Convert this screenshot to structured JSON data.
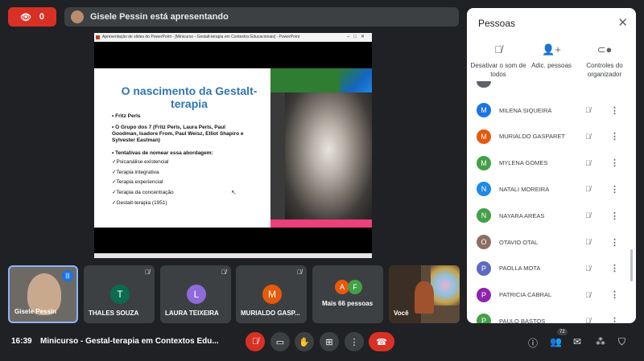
{
  "topbar": {
    "viewer_count": "0",
    "presenting_text": "Gisele Pessin está apresentando"
  },
  "slide": {
    "window_title": "Apresentação de slides do PowerPoint - [Minicurso - Gestalt-terapia em Contextos Educacionais] - PowerPoint",
    "title": "O nascimento da Gestalt-terapia",
    "bullets": [
      "Fritz Perls",
      "O Grupo dos 7 (Fritz Perls, Laura Perls, Paul Goodman, Isadore From, Paul Weisz, Elliot Shapiro e Sylvester Eastman)",
      "Tentativas de nomear essa abordagem:"
    ],
    "checks": [
      "Psicanálise existencial",
      "Terapia integrativa",
      "Terapia experiencial",
      "Terapia da concentração",
      "Gestalt-terapia (1951)"
    ]
  },
  "panel": {
    "title": "Pessoas",
    "actions": [
      "Desativar o som de todos",
      "Adic. pessoas",
      "Controles do organizador"
    ],
    "people": [
      {
        "initial": "M",
        "name": "MILENA SIQUEIRA",
        "color": "#1a73e8"
      },
      {
        "initial": "M",
        "name": "MURIALDO GASPARET",
        "color": "#e8590c"
      },
      {
        "initial": "M",
        "name": "MYLENA GOMES",
        "color": "#43a047"
      },
      {
        "initial": "N",
        "name": "NATALI MOREIRA",
        "color": "#1e88e5"
      },
      {
        "initial": "N",
        "name": "NAYARA AREAS",
        "color": "#43a047"
      },
      {
        "initial": "O",
        "name": "OTAVIO OTAL",
        "color": "#8d6e63"
      },
      {
        "initial": "P",
        "name": "PAOLLA MOTA",
        "color": "#5c6bc0"
      },
      {
        "initial": "P",
        "name": "PATRICIA CABRAL",
        "color": "#8e24aa"
      },
      {
        "initial": "P",
        "name": "PAULO BASTOS",
        "color": "#43a047"
      }
    ]
  },
  "tiles": [
    {
      "name": "Gisele Pessin"
    },
    {
      "name": "THALES SOUZA",
      "initial": "T",
      "color": "#0b6b4f"
    },
    {
      "name": "LAURA TEIXEIRA",
      "initial": "L",
      "color": "#8e6bd8"
    },
    {
      "name": "MURIALDO GASP...",
      "initial": "M",
      "color": "#e8590c"
    },
    {
      "name": "Mais 66 pessoas",
      "initials": [
        "A",
        "F"
      ]
    },
    {
      "name": "Você"
    }
  ],
  "bottombar": {
    "time": "16:39",
    "meeting_title": "Minicurso - Gestal-terapia em Contextos Edu...",
    "people_count": "72"
  }
}
